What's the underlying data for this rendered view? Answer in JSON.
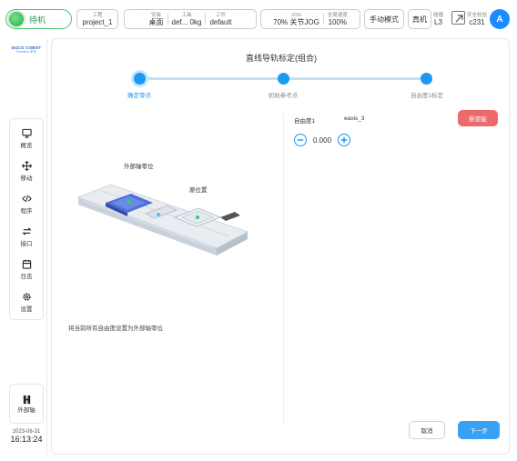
{
  "topbar": {
    "status": "待机",
    "project": {
      "label": "工程",
      "value": "project_1"
    },
    "install": {
      "label": "安装",
      "value": "桌面"
    },
    "tool": {
      "label": "工具",
      "value": "def... 0kg"
    },
    "workpiece": {
      "label": "工件",
      "value": "default"
    },
    "jog": {
      "label": "JOG",
      "left": "70%",
      "right": "关节JOG"
    },
    "speed": {
      "label": "全局速度",
      "value": "100%"
    },
    "mode_button": "手动模式",
    "real_button": "真机",
    "collision": {
      "label": "碰撞",
      "value": "L3"
    },
    "safety": {
      "label": "安全校验",
      "value": "c231"
    },
    "avatar": "A"
  },
  "brand": {
    "name": "DUCO COBOT",
    "series": "Premium 系列"
  },
  "sidebar": {
    "items": [
      {
        "label": "概览",
        "icon": "monitor-icon"
      },
      {
        "label": "移动",
        "icon": "move-icon"
      },
      {
        "label": "程序",
        "icon": "code-icon"
      },
      {
        "label": "接口",
        "icon": "interface-icon"
      },
      {
        "label": "日志",
        "icon": "calendar-icon"
      },
      {
        "label": "设置",
        "icon": "gear-icon"
      }
    ],
    "external_axis": "外部轴",
    "date": "2023-08-31",
    "time": "16:13:24"
  },
  "main": {
    "title": "直线导轨标定(组合)",
    "steps": [
      {
        "label": "确定零点",
        "active": true
      },
      {
        "label": "初始参考点",
        "active": false
      },
      {
        "label": "自由度1标定",
        "active": false
      }
    ],
    "illustration": {
      "label_zero": "外部轴零位",
      "label_origin": "原位置"
    },
    "description": "将当前所有自由度设置为外部轴零位",
    "joint": {
      "name": "自由度1",
      "axis": "eaxis_3",
      "value": "0.000"
    },
    "stop_button": "断使能",
    "cancel_button": "取消",
    "next_button": "下一步"
  },
  "colors": {
    "accent": "#1a9af0",
    "status_green": "#4cc26a",
    "stop_red": "#ec6a6a"
  }
}
